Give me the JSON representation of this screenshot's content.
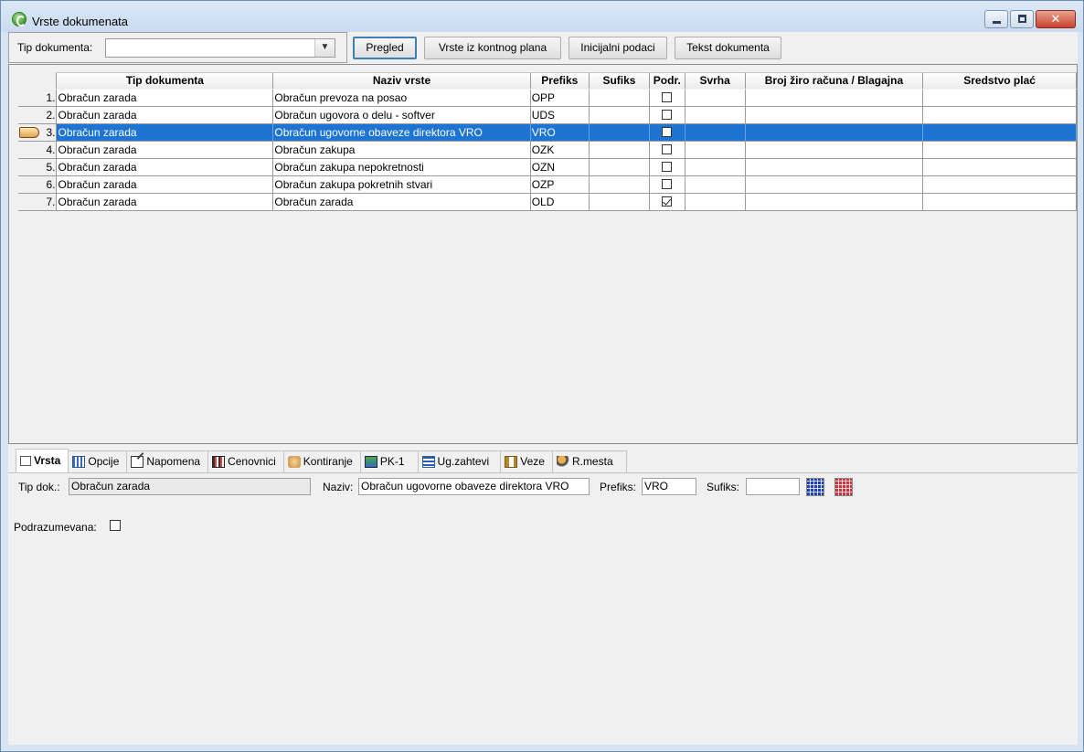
{
  "window": {
    "title": "Vrste dokumenata"
  },
  "toolbar": {
    "tip_label": "Tip dokumenta:",
    "tip_value": "",
    "btn_pregled": "Pregled",
    "btn_vrste": "Vrste iz kontnog plana",
    "btn_inicijalni": "Inicijalni podaci",
    "btn_tekst": "Tekst dokumenta"
  },
  "grid": {
    "columns": [
      "Tip dokumenta",
      "Naziv vrste",
      "Prefiks",
      "Sufiks",
      "Podr.",
      "Svrha",
      "Broj žiro računa / Blagajna",
      "Sredstvo plać"
    ],
    "rows": [
      {
        "n": "1.",
        "tip": "Obračun zarada",
        "naziv": "Obračun prevoza na posao",
        "prefiks": "OPP",
        "sufiks": "",
        "podr": false,
        "svrha": "",
        "broj": "",
        "sredstvo": ""
      },
      {
        "n": "2.",
        "tip": "Obračun zarada",
        "naziv": "Obračun ugovora o delu - softver",
        "prefiks": "UDS",
        "sufiks": "",
        "podr": false,
        "svrha": "",
        "broj": "",
        "sredstvo": ""
      },
      {
        "n": "3.",
        "tip": "Obračun zarada",
        "naziv": "Obračun ugovorne obaveze direktora VRO",
        "prefiks": "VRO",
        "sufiks": "",
        "podr": false,
        "svrha": "",
        "broj": "",
        "sredstvo": "",
        "selected": true
      },
      {
        "n": "4.",
        "tip": "Obračun zarada",
        "naziv": "Obračun zakupa",
        "prefiks": "OZK",
        "sufiks": "",
        "podr": false,
        "svrha": "",
        "broj": "",
        "sredstvo": ""
      },
      {
        "n": "5.",
        "tip": "Obračun zarada",
        "naziv": "Obračun zakupa nepokretnosti",
        "prefiks": "OZN",
        "sufiks": "",
        "podr": false,
        "svrha": "",
        "broj": "",
        "sredstvo": ""
      },
      {
        "n": "6.",
        "tip": "Obračun zarada",
        "naziv": "Obračun zakupa pokretnih stvari",
        "prefiks": "OZP",
        "sufiks": "",
        "podr": false,
        "svrha": "",
        "broj": "",
        "sredstvo": ""
      },
      {
        "n": "7.",
        "tip": "Obračun zarada",
        "naziv": "Obračun zarada",
        "prefiks": "OLD",
        "sufiks": "",
        "podr": true,
        "svrha": "",
        "broj": "",
        "sredstvo": ""
      }
    ]
  },
  "tabs": [
    {
      "label": "Vrsta",
      "icon": "document-icon"
    },
    {
      "label": "Opcije",
      "icon": "options-icon"
    },
    {
      "label": "Napomena",
      "icon": "note-icon"
    },
    {
      "label": "Cenovnici",
      "icon": "price-list-icon"
    },
    {
      "label": "Kontiranje",
      "icon": "posting-icon"
    },
    {
      "label": "PK-1",
      "icon": "pk1-icon"
    },
    {
      "label": "Ug.zahtevi",
      "icon": "requests-icon"
    },
    {
      "label": "Veze",
      "icon": "links-icon"
    },
    {
      "label": "R.mesta",
      "icon": "workplace-icon"
    }
  ],
  "detail": {
    "tip_label": "Tip dok.:",
    "tip_value": "Obračun zarada",
    "naziv_label": "Naziv:",
    "naziv_value": "Obračun ugovorne obaveze direktora VRO",
    "prefiks_label": "Prefiks:",
    "prefiks_value": "VRO",
    "sufiks_label": "Sufiks:",
    "sufiks_value": "",
    "podraz_label": "Podrazumevana:"
  }
}
